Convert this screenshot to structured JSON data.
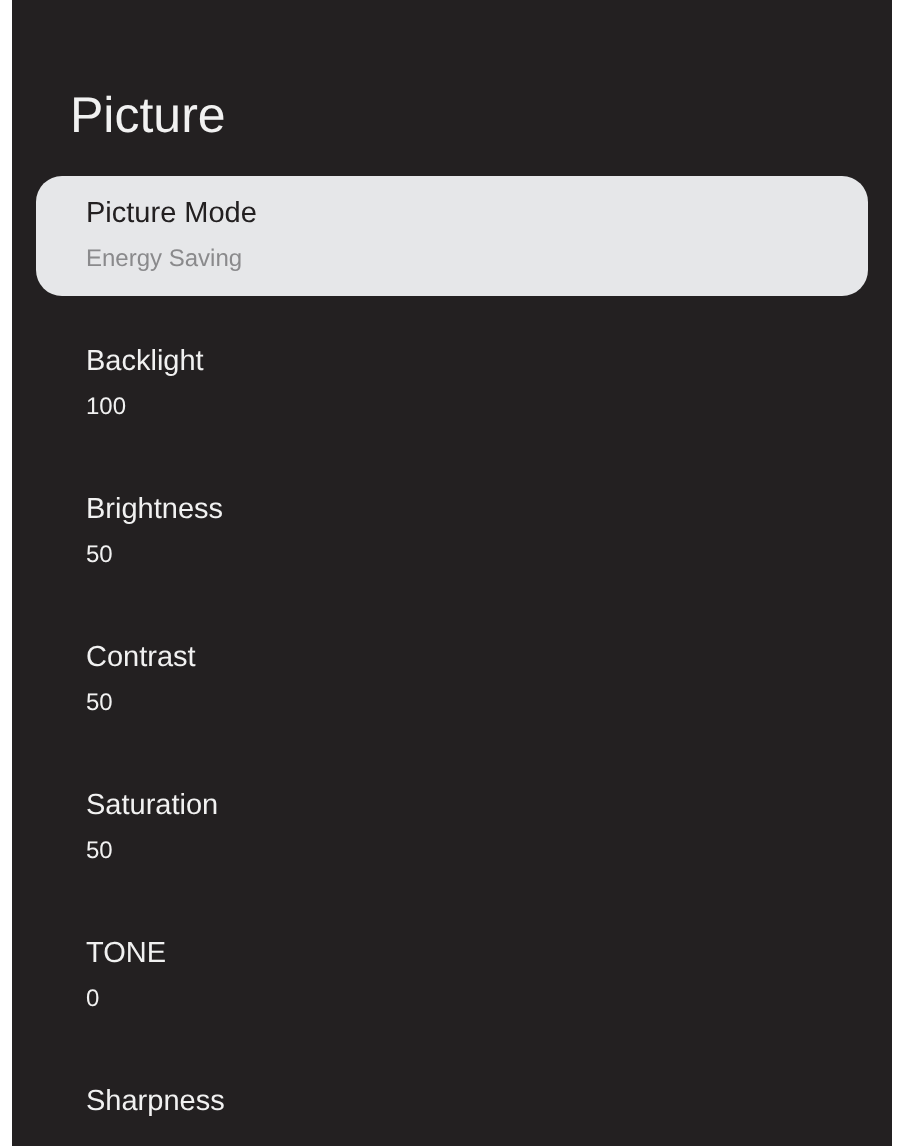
{
  "title": "Picture",
  "items": [
    {
      "label": "Picture Mode",
      "value": "Energy Saving",
      "selected": true
    },
    {
      "label": "Backlight",
      "value": "100",
      "selected": false
    },
    {
      "label": "Brightness",
      "value": "50",
      "selected": false
    },
    {
      "label": "Contrast",
      "value": "50",
      "selected": false
    },
    {
      "label": "Saturation",
      "value": "50",
      "selected": false
    },
    {
      "label": "TONE",
      "value": "0",
      "selected": false
    },
    {
      "label": "Sharpness",
      "selected": false
    }
  ]
}
